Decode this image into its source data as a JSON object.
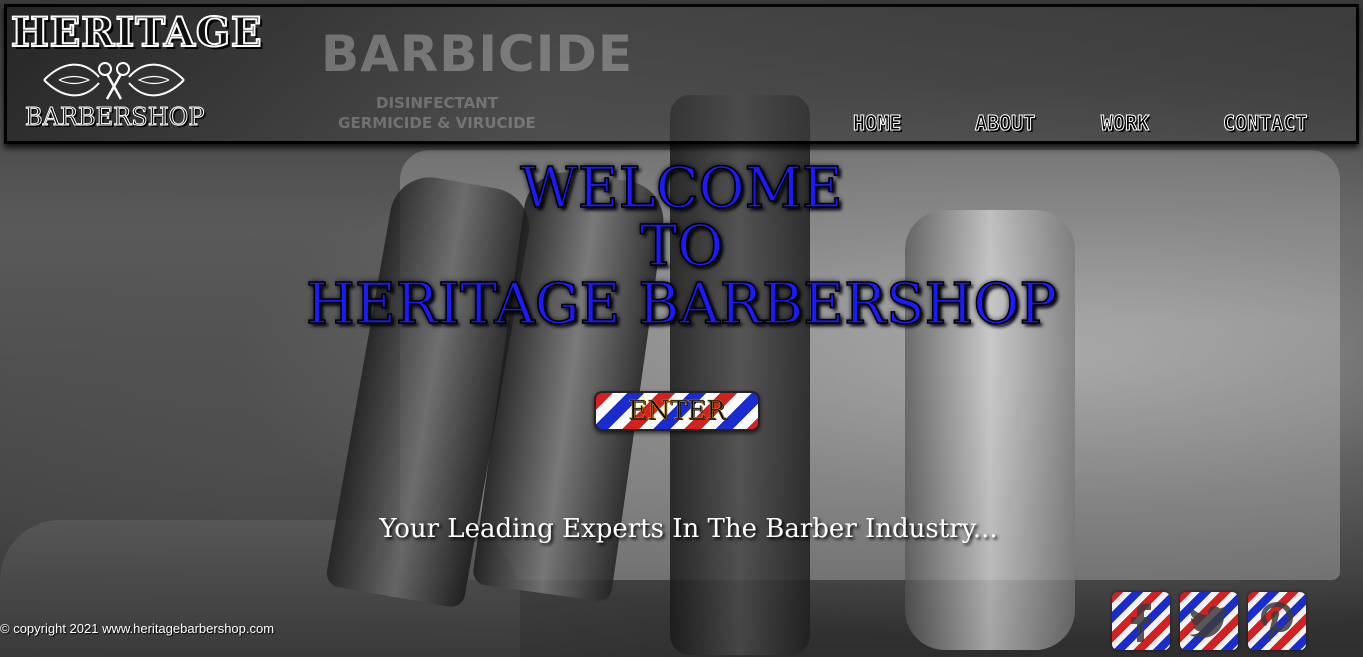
{
  "header": {
    "logo_top": "HERITAGE",
    "logo_bottom": "BARBERSHOP",
    "background_sign": "BARBICIDE",
    "background_sign_sub": "DISINFECTANT GERMICIDE & VIRUCIDE"
  },
  "nav": {
    "items": [
      {
        "label": "HOME"
      },
      {
        "label": "ABOUT"
      },
      {
        "label": "WORK"
      },
      {
        "label": "CONTACT"
      }
    ]
  },
  "hero": {
    "title_line1": "WELCOME",
    "title_line2": "TO",
    "title_line3": "HERITAGE BARBERSHOP",
    "enter_label": "ENTER",
    "tagline": "Your Leading Experts In The Barber Industry..."
  },
  "footer": {
    "copyright": "© copyright 2021 www.heritagebarbershop.com",
    "socials": [
      {
        "icon": "facebook-icon"
      },
      {
        "icon": "twitter-icon"
      },
      {
        "icon": "pinterest-icon"
      }
    ]
  },
  "colors": {
    "title_blue": "#1a1aff",
    "pole_red": "#d42020",
    "pole_blue": "#1a2ccf",
    "pole_white": "#ffffff"
  }
}
